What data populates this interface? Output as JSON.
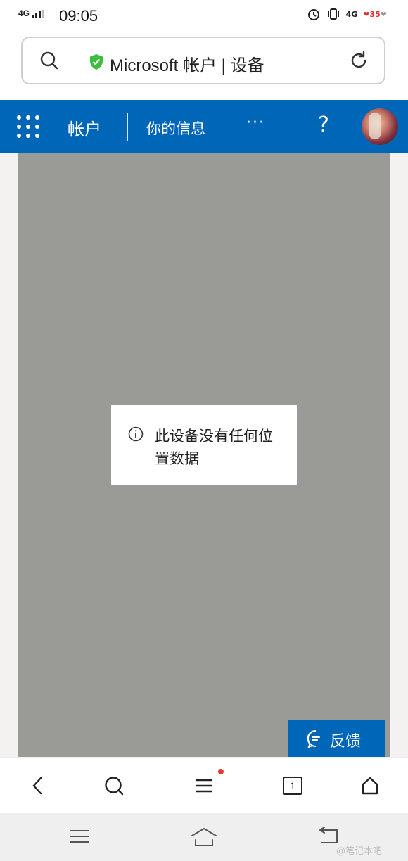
{
  "status_bar": {
    "network": "4G",
    "time": "09:05",
    "network2": "4G",
    "battery_badge": "35"
  },
  "address_bar": {
    "title": "Microsoft 帐户 | 设备"
  },
  "header": {
    "account": "帐户",
    "your_info": "你的信息",
    "more": "···",
    "help": "?"
  },
  "map": {
    "message": "此设备没有任何位置数据"
  },
  "feedback": {
    "label": "反馈"
  },
  "browser_toolbar": {
    "tab_count": "1"
  },
  "watermark": "@笔记本吧",
  "colors": {
    "brand_blue": "#0067b8",
    "map_gray": "#9a9a96",
    "shield_green": "#3cbe3c",
    "notification_dot": "#e53935"
  }
}
